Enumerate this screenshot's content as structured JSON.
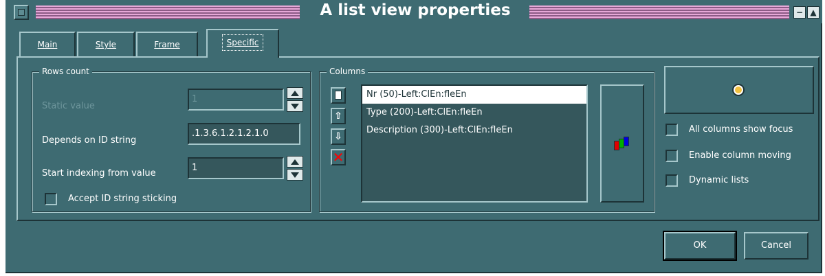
{
  "window": {
    "title": "A list view properties",
    "minimize_glyph": "−",
    "maximize_glyph": "▲"
  },
  "tabs": [
    {
      "label": "Main",
      "active": false
    },
    {
      "label": "Style",
      "active": false
    },
    {
      "label": "Frame",
      "active": false
    },
    {
      "label": "Specific",
      "active": true
    }
  ],
  "rows_count": {
    "title": "Rows count",
    "static_value_label": "Static value",
    "static_value": "1",
    "depends_label": "Depends on ID string",
    "depends_value": ".1.3.6.1.2.1.2.1.0",
    "start_index_label": "Start indexing from value",
    "start_index_value": "1",
    "accept_label": "Accept ID string sticking",
    "accept_checked": false
  },
  "columns": {
    "title": "Columns",
    "items": [
      "Nr (50)-Left:ClEn:fleEn",
      "Type (200)-Left:ClEn:fleEn",
      "Description (300)-Left:ClEn:fleEn"
    ],
    "selected_index": 0,
    "tool_icons": [
      "new-document-icon",
      "move-up-icon",
      "move-down-icon",
      "delete-icon"
    ],
    "color_icon": "column-colors-icon"
  },
  "options": {
    "all_columns_focus": "All columns show focus",
    "enable_column_moving": "Enable column moving",
    "dynamic_lists": "Dynamic lists",
    "top_button_icon": "sun-icon"
  },
  "buttons": {
    "ok": "OK",
    "cancel": "Cancel"
  },
  "colors": {
    "background": "#3e6b72",
    "title_stripe": "#e6a8d8",
    "selection": "#ffffff",
    "delete": "#ff0000"
  }
}
